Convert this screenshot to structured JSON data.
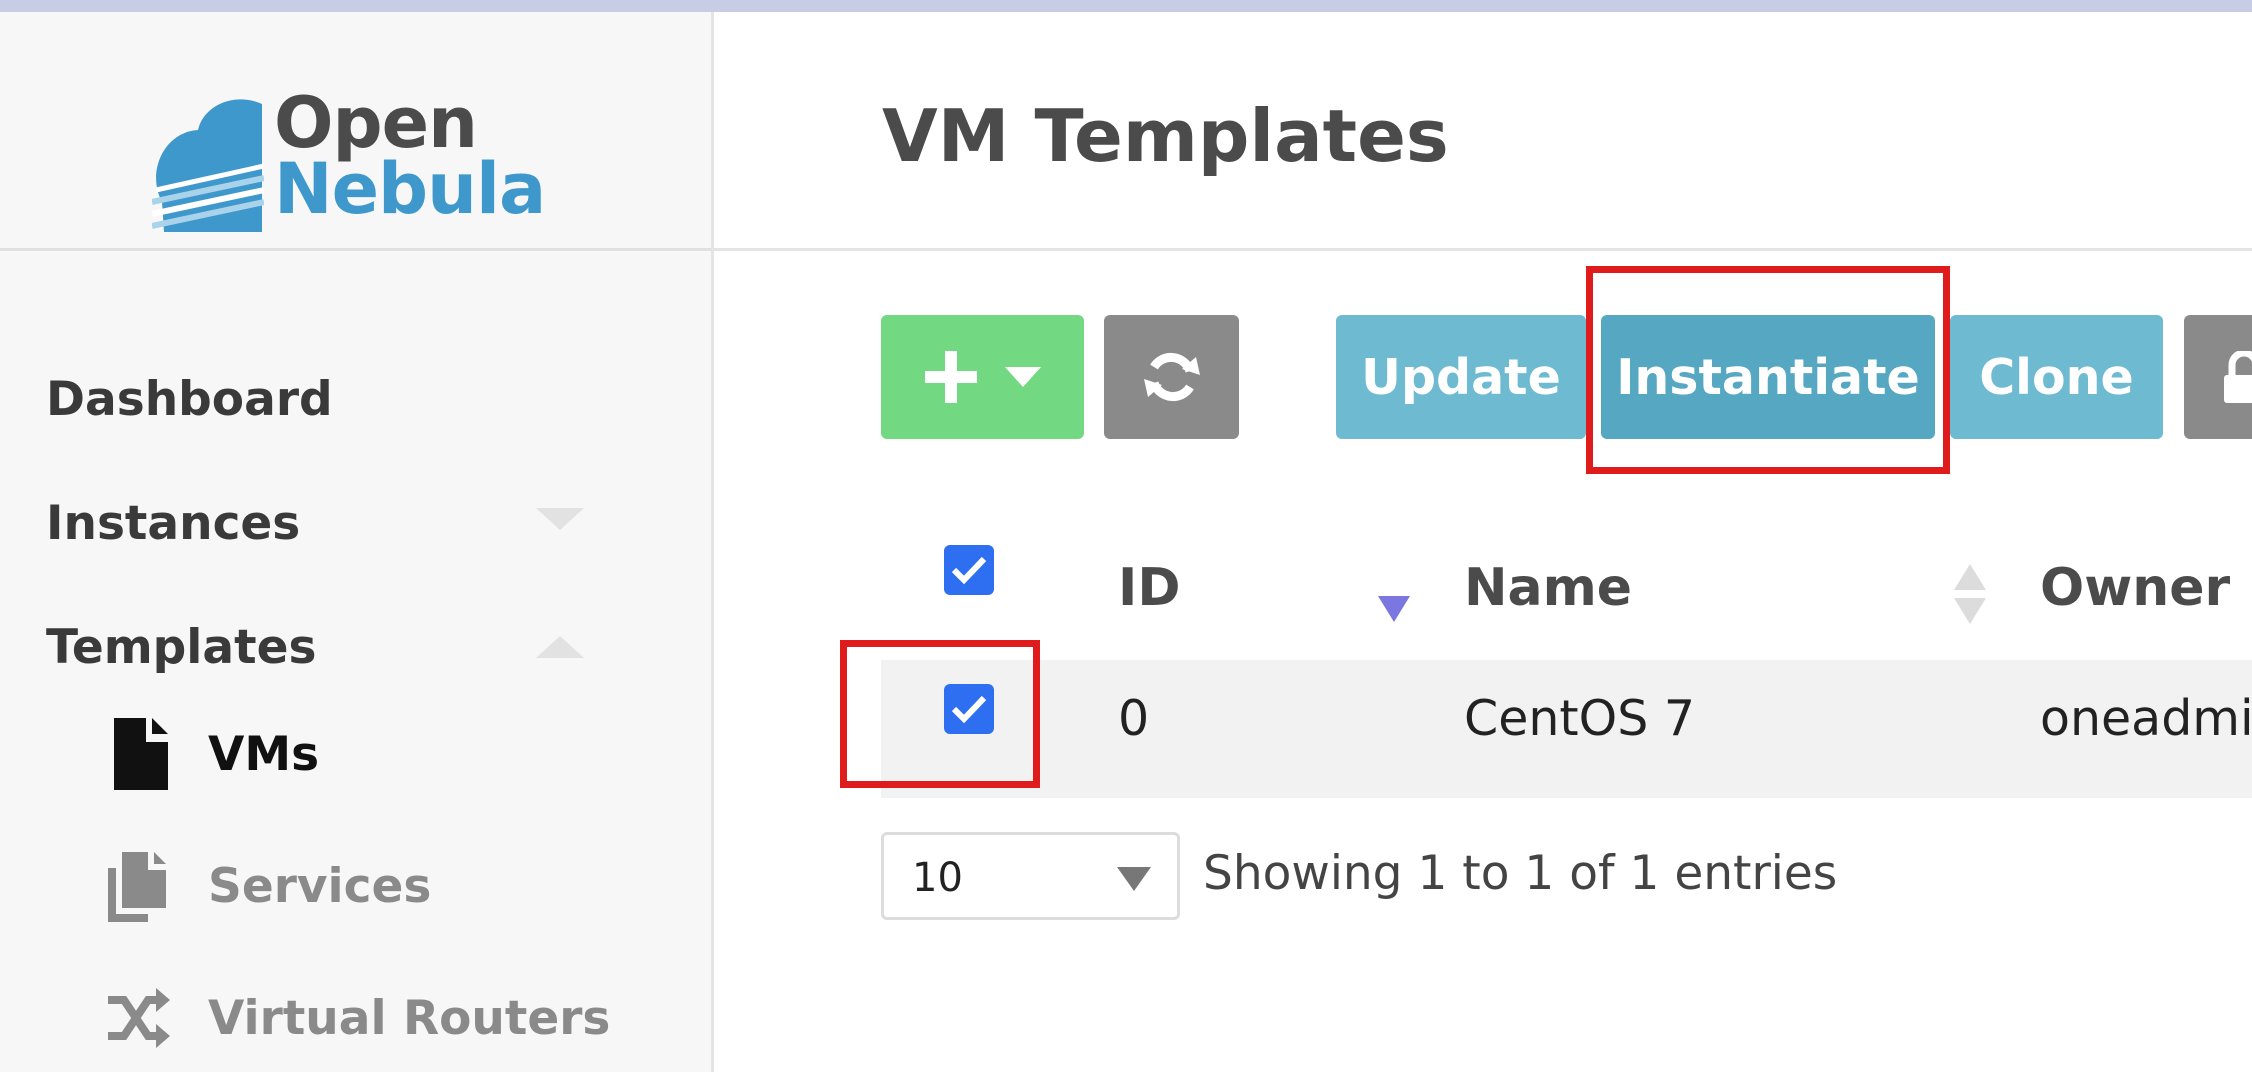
{
  "logo": {
    "line1": "Open",
    "line2": "Nebula"
  },
  "page_title": "VM Templates",
  "sidebar": {
    "items": [
      {
        "label": "Dashboard"
      },
      {
        "label": "Instances"
      },
      {
        "label": "Templates"
      }
    ],
    "subitems": [
      {
        "label": "VMs",
        "icon": "document-icon",
        "active": true
      },
      {
        "label": "Services",
        "icon": "files-icon",
        "active": false
      },
      {
        "label": "Virtual Routers",
        "icon": "shuffle-icon",
        "active": false
      }
    ]
  },
  "toolbar": {
    "create_icon": "plus-icon",
    "refresh_icon": "refresh-icon",
    "update_label": "Update",
    "instantiate_label": "Instantiate",
    "clone_label": "Clone",
    "lock_icon": "lock-icon"
  },
  "table": {
    "columns": [
      "ID",
      "Name",
      "Owner"
    ],
    "rows": [
      {
        "id": "0",
        "name": "CentOS 7",
        "owner": "oneadmin",
        "checked": true
      }
    ],
    "select_all_checked": true
  },
  "pagination": {
    "page_size": "10",
    "entries_text": "Showing 1 to 1 of 1 entries"
  },
  "colors": {
    "accent": "#56a7c2",
    "create": "#72d982",
    "highlight": "#e01b1b",
    "checkbox": "#2d6ff0"
  }
}
